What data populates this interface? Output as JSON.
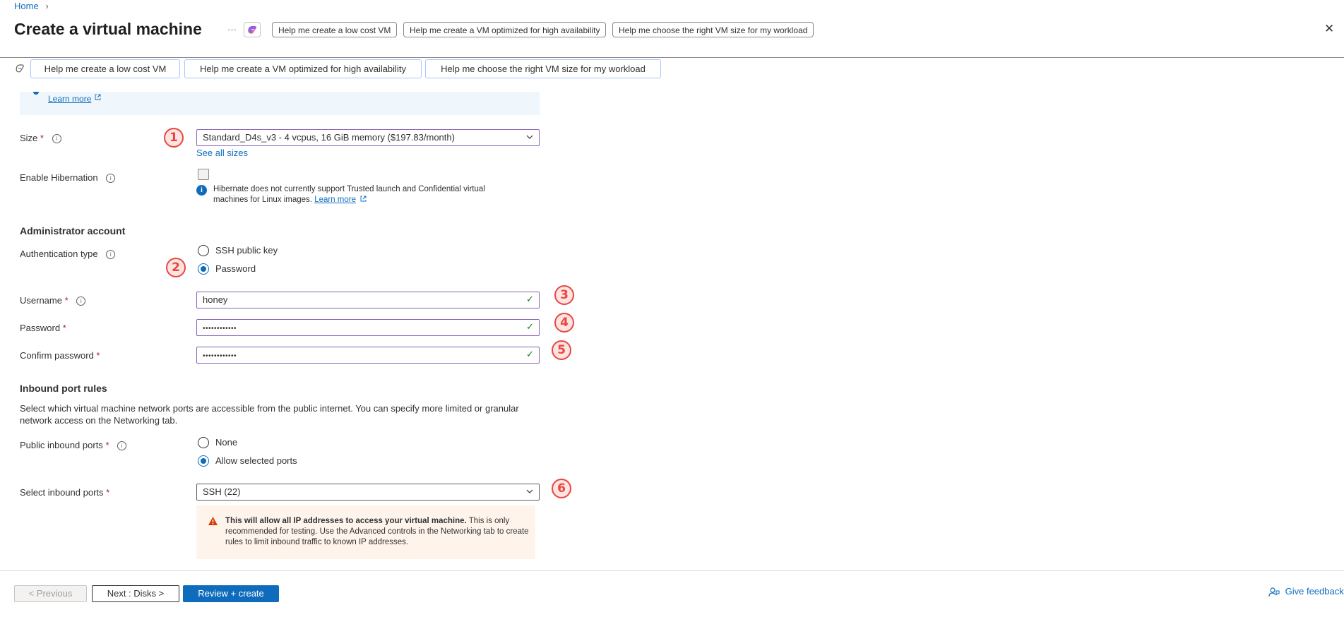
{
  "header": {
    "breadcrumb_home": "Home",
    "breadcrumb_sep": "›",
    "title": "Create a virtual machine",
    "more": "···",
    "close": "✕",
    "copilot_chips": [
      "Help me create a low cost VM",
      "Help me create a VM optimized for high availability",
      "Help me choose the right VM size for my workload"
    ]
  },
  "copilot_bar": {
    "chips": [
      "Help me create a low cost VM",
      "Help me create a VM optimized for high availability",
      "Help me choose the right VM size for my workload"
    ]
  },
  "banner": {
    "learn_more": "Learn more"
  },
  "size": {
    "label": "Size",
    "required": "*",
    "value": "Standard_D4s_v3 - 4 vcpus, 16 GiB memory ($197.83/month)",
    "see_all": "See all sizes"
  },
  "hibernation": {
    "label": "Enable Hibernation",
    "note": "Hibernate does not currently support Trusted launch and Confidential virtual machines for Linux images.",
    "learn_more": "Learn more"
  },
  "admin": {
    "heading": "Administrator account",
    "auth_label": "Authentication type",
    "auth_options": [
      "SSH public key",
      "Password"
    ],
    "auth_selected": "Password",
    "username_label": "Username",
    "username_value": "honey",
    "password_label": "Password",
    "password_value": "••••••••••••",
    "confirm_label": "Confirm password",
    "confirm_value": "••••••••••••",
    "required": "*"
  },
  "inbound": {
    "heading": "Inbound port rules",
    "description": "Select which virtual machine network ports are accessible from the public internet. You can specify more limited or granular network access on the Networking tab.",
    "public_label": "Public inbound ports",
    "public_options": [
      "None",
      "Allow selected ports"
    ],
    "public_selected": "Allow selected ports",
    "select_label": "Select inbound ports",
    "select_value": "SSH (22)",
    "required": "*",
    "warning_bold": "This will allow all IP addresses to access your virtual machine.",
    "warning_text": " This is only recommended for testing.  Use the Advanced controls in the Networking tab to create rules to limit inbound traffic to known IP addresses."
  },
  "markers": [
    "1",
    "2",
    "3",
    "4",
    "5",
    "6"
  ],
  "footer": {
    "previous": "< Previous",
    "next": "Next : Disks >",
    "review": "Review + create",
    "feedback": "Give feedback"
  },
  "colors": {
    "accent": "#0f6cbd",
    "marker": "#e8473f",
    "field_border": "#8764b8",
    "valid": "#107c10"
  }
}
